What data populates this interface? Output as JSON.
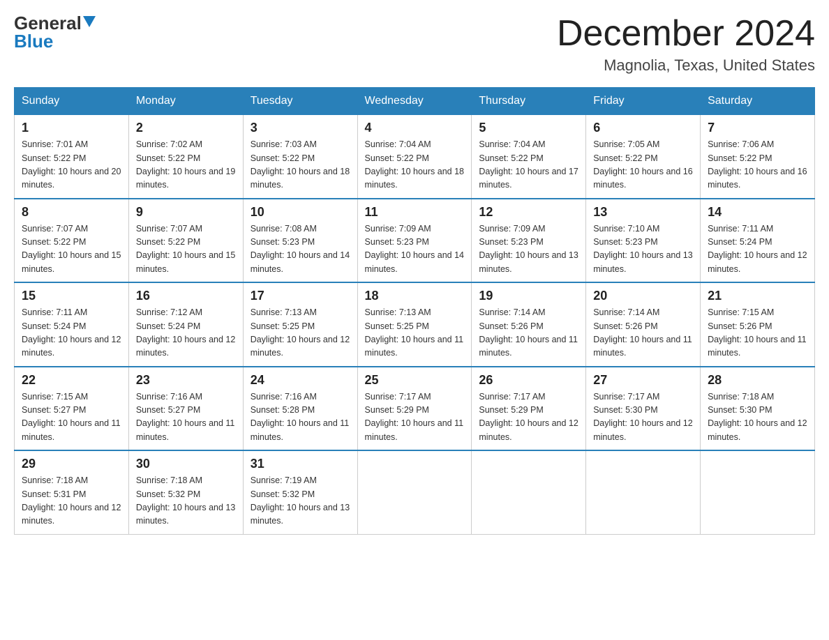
{
  "header": {
    "logo_general": "General",
    "logo_blue": "Blue",
    "title": "December 2024",
    "subtitle": "Magnolia, Texas, United States"
  },
  "days_of_week": [
    "Sunday",
    "Monday",
    "Tuesday",
    "Wednesday",
    "Thursday",
    "Friday",
    "Saturday"
  ],
  "weeks": [
    [
      {
        "day": "1",
        "sunrise": "Sunrise: 7:01 AM",
        "sunset": "Sunset: 5:22 PM",
        "daylight": "Daylight: 10 hours and 20 minutes."
      },
      {
        "day": "2",
        "sunrise": "Sunrise: 7:02 AM",
        "sunset": "Sunset: 5:22 PM",
        "daylight": "Daylight: 10 hours and 19 minutes."
      },
      {
        "day": "3",
        "sunrise": "Sunrise: 7:03 AM",
        "sunset": "Sunset: 5:22 PM",
        "daylight": "Daylight: 10 hours and 18 minutes."
      },
      {
        "day": "4",
        "sunrise": "Sunrise: 7:04 AM",
        "sunset": "Sunset: 5:22 PM",
        "daylight": "Daylight: 10 hours and 18 minutes."
      },
      {
        "day": "5",
        "sunrise": "Sunrise: 7:04 AM",
        "sunset": "Sunset: 5:22 PM",
        "daylight": "Daylight: 10 hours and 17 minutes."
      },
      {
        "day": "6",
        "sunrise": "Sunrise: 7:05 AM",
        "sunset": "Sunset: 5:22 PM",
        "daylight": "Daylight: 10 hours and 16 minutes."
      },
      {
        "day": "7",
        "sunrise": "Sunrise: 7:06 AM",
        "sunset": "Sunset: 5:22 PM",
        "daylight": "Daylight: 10 hours and 16 minutes."
      }
    ],
    [
      {
        "day": "8",
        "sunrise": "Sunrise: 7:07 AM",
        "sunset": "Sunset: 5:22 PM",
        "daylight": "Daylight: 10 hours and 15 minutes."
      },
      {
        "day": "9",
        "sunrise": "Sunrise: 7:07 AM",
        "sunset": "Sunset: 5:22 PM",
        "daylight": "Daylight: 10 hours and 15 minutes."
      },
      {
        "day": "10",
        "sunrise": "Sunrise: 7:08 AM",
        "sunset": "Sunset: 5:23 PM",
        "daylight": "Daylight: 10 hours and 14 minutes."
      },
      {
        "day": "11",
        "sunrise": "Sunrise: 7:09 AM",
        "sunset": "Sunset: 5:23 PM",
        "daylight": "Daylight: 10 hours and 14 minutes."
      },
      {
        "day": "12",
        "sunrise": "Sunrise: 7:09 AM",
        "sunset": "Sunset: 5:23 PM",
        "daylight": "Daylight: 10 hours and 13 minutes."
      },
      {
        "day": "13",
        "sunrise": "Sunrise: 7:10 AM",
        "sunset": "Sunset: 5:23 PM",
        "daylight": "Daylight: 10 hours and 13 minutes."
      },
      {
        "day": "14",
        "sunrise": "Sunrise: 7:11 AM",
        "sunset": "Sunset: 5:24 PM",
        "daylight": "Daylight: 10 hours and 12 minutes."
      }
    ],
    [
      {
        "day": "15",
        "sunrise": "Sunrise: 7:11 AM",
        "sunset": "Sunset: 5:24 PM",
        "daylight": "Daylight: 10 hours and 12 minutes."
      },
      {
        "day": "16",
        "sunrise": "Sunrise: 7:12 AM",
        "sunset": "Sunset: 5:24 PM",
        "daylight": "Daylight: 10 hours and 12 minutes."
      },
      {
        "day": "17",
        "sunrise": "Sunrise: 7:13 AM",
        "sunset": "Sunset: 5:25 PM",
        "daylight": "Daylight: 10 hours and 12 minutes."
      },
      {
        "day": "18",
        "sunrise": "Sunrise: 7:13 AM",
        "sunset": "Sunset: 5:25 PM",
        "daylight": "Daylight: 10 hours and 11 minutes."
      },
      {
        "day": "19",
        "sunrise": "Sunrise: 7:14 AM",
        "sunset": "Sunset: 5:26 PM",
        "daylight": "Daylight: 10 hours and 11 minutes."
      },
      {
        "day": "20",
        "sunrise": "Sunrise: 7:14 AM",
        "sunset": "Sunset: 5:26 PM",
        "daylight": "Daylight: 10 hours and 11 minutes."
      },
      {
        "day": "21",
        "sunrise": "Sunrise: 7:15 AM",
        "sunset": "Sunset: 5:26 PM",
        "daylight": "Daylight: 10 hours and 11 minutes."
      }
    ],
    [
      {
        "day": "22",
        "sunrise": "Sunrise: 7:15 AM",
        "sunset": "Sunset: 5:27 PM",
        "daylight": "Daylight: 10 hours and 11 minutes."
      },
      {
        "day": "23",
        "sunrise": "Sunrise: 7:16 AM",
        "sunset": "Sunset: 5:27 PM",
        "daylight": "Daylight: 10 hours and 11 minutes."
      },
      {
        "day": "24",
        "sunrise": "Sunrise: 7:16 AM",
        "sunset": "Sunset: 5:28 PM",
        "daylight": "Daylight: 10 hours and 11 minutes."
      },
      {
        "day": "25",
        "sunrise": "Sunrise: 7:17 AM",
        "sunset": "Sunset: 5:29 PM",
        "daylight": "Daylight: 10 hours and 11 minutes."
      },
      {
        "day": "26",
        "sunrise": "Sunrise: 7:17 AM",
        "sunset": "Sunset: 5:29 PM",
        "daylight": "Daylight: 10 hours and 12 minutes."
      },
      {
        "day": "27",
        "sunrise": "Sunrise: 7:17 AM",
        "sunset": "Sunset: 5:30 PM",
        "daylight": "Daylight: 10 hours and 12 minutes."
      },
      {
        "day": "28",
        "sunrise": "Sunrise: 7:18 AM",
        "sunset": "Sunset: 5:30 PM",
        "daylight": "Daylight: 10 hours and 12 minutes."
      }
    ],
    [
      {
        "day": "29",
        "sunrise": "Sunrise: 7:18 AM",
        "sunset": "Sunset: 5:31 PM",
        "daylight": "Daylight: 10 hours and 12 minutes."
      },
      {
        "day": "30",
        "sunrise": "Sunrise: 7:18 AM",
        "sunset": "Sunset: 5:32 PM",
        "daylight": "Daylight: 10 hours and 13 minutes."
      },
      {
        "day": "31",
        "sunrise": "Sunrise: 7:19 AM",
        "sunset": "Sunset: 5:32 PM",
        "daylight": "Daylight: 10 hours and 13 minutes."
      },
      null,
      null,
      null,
      null
    ]
  ]
}
